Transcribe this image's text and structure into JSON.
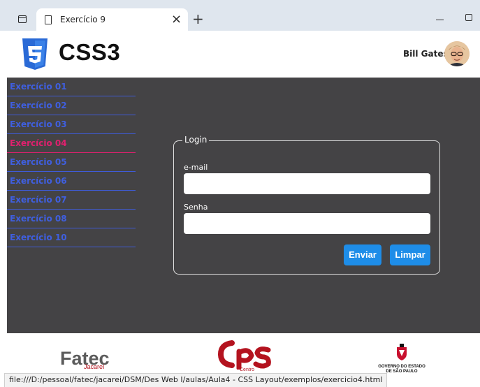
{
  "browser": {
    "tab_title": "Exercício 9",
    "close_glyph": "×",
    "new_tab_glyph": "+"
  },
  "header": {
    "brand": "CSS3",
    "user_name": "Bill Gates"
  },
  "nav": {
    "items": [
      {
        "label": "Exercício 01",
        "active": false
      },
      {
        "label": "Exercício 02",
        "active": false
      },
      {
        "label": "Exercício 03",
        "active": false
      },
      {
        "label": "Exercício 04",
        "active": true
      },
      {
        "label": "Exercício 05",
        "active": false
      },
      {
        "label": "Exercício 06",
        "active": false
      },
      {
        "label": "Exercício 07",
        "active": false
      },
      {
        "label": "Exercício 08",
        "active": false
      },
      {
        "label": "Exercício 10",
        "active": false
      }
    ]
  },
  "login": {
    "legend": "Login",
    "email_label": "e-mail",
    "email_value": "",
    "password_label": "Senha",
    "password_value": "",
    "submit_label": "Enviar",
    "reset_label": "Limpar"
  },
  "footer": {
    "fatec": "Fatec",
    "fatec_sub": "Jacareí",
    "cps_sub": "Centro",
    "gov_line1": "GOVERNO DO ESTADO",
    "gov_line2": "DE SÃO PAULO"
  },
  "status_bar": "file:///D:/pessoal/fatec/jacarei/DSM/Des Web I/aulas/Aula4 - CSS Layout/exemplos/exercicio4.html",
  "colors": {
    "main_bg": "#444345",
    "nav_link": "#3f5fe0",
    "nav_active": "#e0206e",
    "button": "#1e8de8",
    "css_logo": "#2a6ad6"
  }
}
